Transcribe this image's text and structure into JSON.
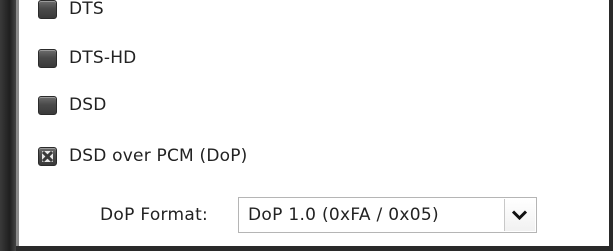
{
  "options": [
    {
      "label": "DTS",
      "checked": false
    },
    {
      "label": "DTS-HD",
      "checked": false
    },
    {
      "label": "DSD",
      "checked": false
    },
    {
      "label": "DSD over PCM (DoP)",
      "checked": true
    }
  ],
  "dop_format": {
    "label": "DoP Format:",
    "selected": "DoP 1.0 (0xFA / 0x05)"
  },
  "icons": {
    "dropdown": "chevron-down-icon",
    "checkbox_checked": "x-mark-icon"
  }
}
